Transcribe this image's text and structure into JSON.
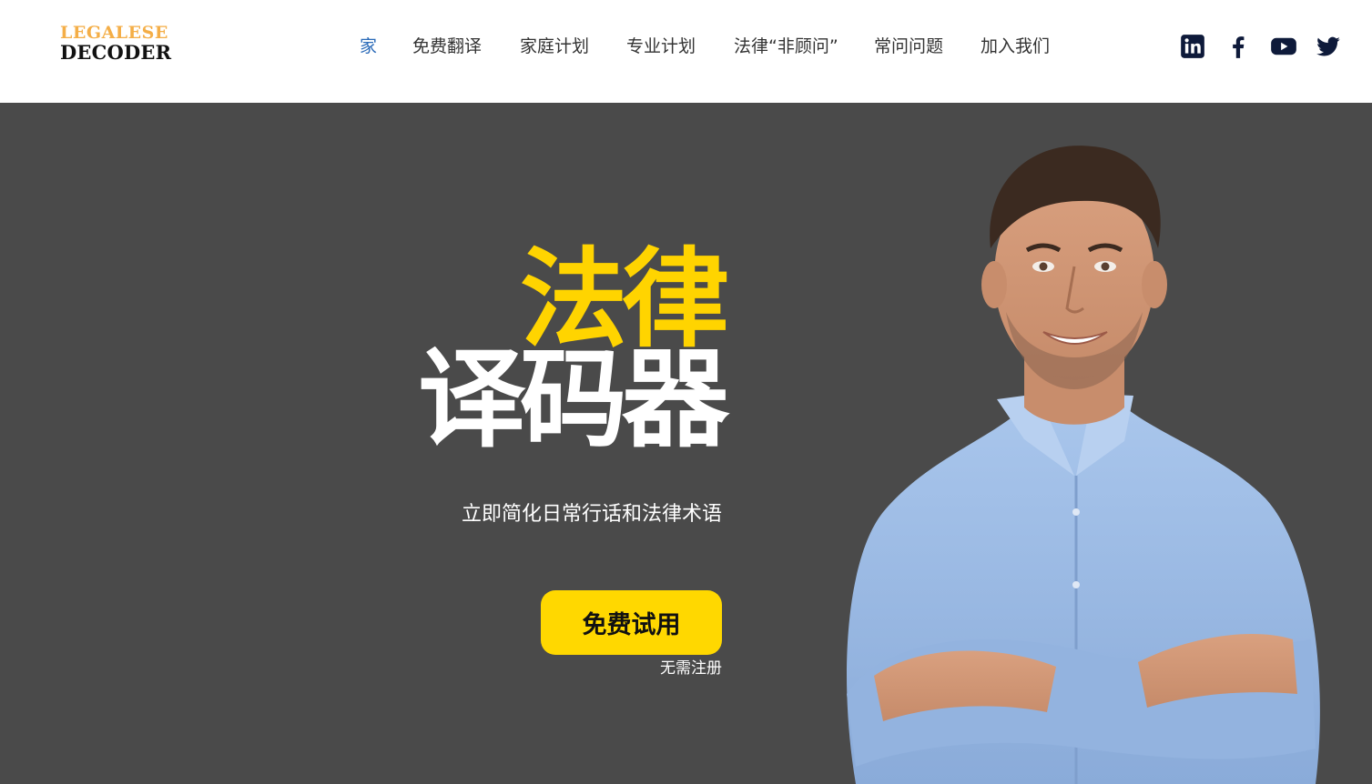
{
  "logo": {
    "line1": "LEGALESE",
    "line2": "DECODER",
    "color_top": "#f4ae47",
    "color_bottom": "#111111"
  },
  "nav": {
    "items": [
      {
        "label": "家",
        "active": true
      },
      {
        "label": "免费翻译",
        "active": false
      },
      {
        "label": "家庭计划",
        "active": false
      },
      {
        "label": "专业计划",
        "active": false
      },
      {
        "label": "法律“非顾问”",
        "active": false
      },
      {
        "label": "常问问题",
        "active": false
      },
      {
        "label": "加入我们",
        "active": false
      }
    ],
    "active_color": "#2a6ab8",
    "text_color": "#333333"
  },
  "socials": [
    {
      "icon": "linkedin-icon"
    },
    {
      "icon": "facebook-icon"
    },
    {
      "icon": "youtube-icon"
    },
    {
      "icon": "twitter-icon"
    }
  ],
  "hero": {
    "headline_line1": "法律",
    "headline_line2": "译码器",
    "subtitle": "立即简化日常行话和法律术语",
    "cta_label": "免费试用",
    "cta_note": "无需注册",
    "background_color": "#4a4a4a",
    "accent_color": "#ffd800"
  }
}
